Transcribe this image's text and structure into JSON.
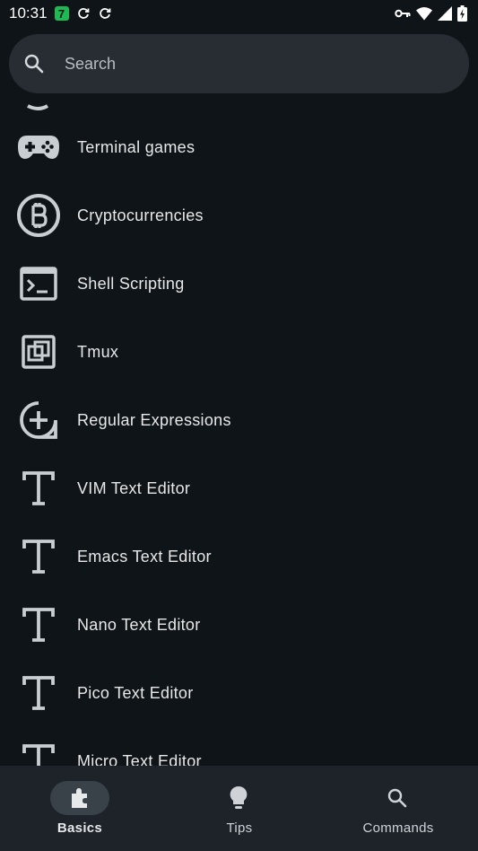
{
  "status_bar": {
    "time": "10:31",
    "badge": "7"
  },
  "search": {
    "placeholder": "Search"
  },
  "list": {
    "items": [
      {
        "label": "Terminal games",
        "icon": "gamepad-icon"
      },
      {
        "label": "Cryptocurrencies",
        "icon": "bitcoin-icon"
      },
      {
        "label": "Shell Scripting",
        "icon": "terminal-icon"
      },
      {
        "label": "Tmux",
        "icon": "tmux-icon"
      },
      {
        "label": "Regular Expressions",
        "icon": "plus-circle-icon"
      },
      {
        "label": "VIM Text Editor",
        "icon": "text-t-icon"
      },
      {
        "label": "Emacs Text Editor",
        "icon": "text-t-icon"
      },
      {
        "label": "Nano Text Editor",
        "icon": "text-t-icon"
      },
      {
        "label": "Pico Text Editor",
        "icon": "text-t-icon"
      },
      {
        "label": "Micro Text Editor",
        "icon": "text-t-icon"
      }
    ]
  },
  "bottom_nav": {
    "items": [
      {
        "label": "Basics",
        "icon": "puzzle-icon",
        "active": true
      },
      {
        "label": "Tips",
        "icon": "lightbulb-icon",
        "active": false
      },
      {
        "label": "Commands",
        "icon": "search-icon",
        "active": false
      }
    ]
  },
  "colors": {
    "background": "#0f1418",
    "search_bg": "#272d33",
    "nav_bg": "#1d2329",
    "icon": "#c9ced3",
    "badge": "#1db954"
  }
}
